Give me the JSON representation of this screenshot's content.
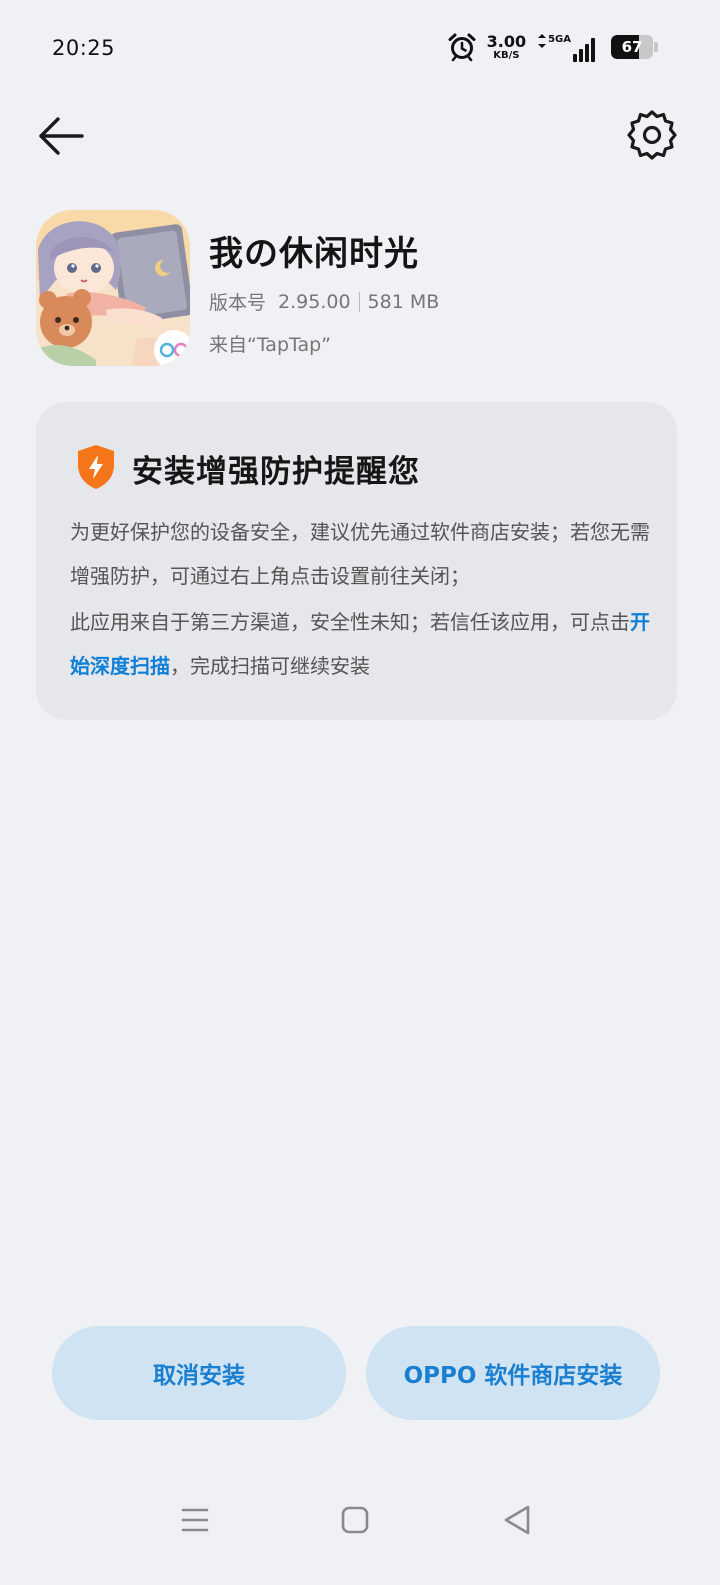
{
  "status_bar": {
    "time": "20:25",
    "speed_value": "3.00",
    "speed_unit": "KB/S",
    "network_label": "5GA",
    "battery_level": "67",
    "battery_fraction": 0.67
  },
  "nav": {
    "back_icon": "arrow-left-icon",
    "settings_icon": "gear-icon"
  },
  "app": {
    "name": "我の休闲时光",
    "version_label": "版本号",
    "version": "2.95.00",
    "size": "581 MB",
    "source": "来自“TapTap”"
  },
  "warning": {
    "icon": "shield-lightning-icon",
    "title": "安装增强防护提醒您",
    "paragraph1": "为更好保护您的设备安全，建议优先通过软件商店安装；若您无需增强防护，可通过右上角点击设置前往关闭；",
    "paragraph2_prefix": "此应用来自于第三方渠道，安全性未知；若信任该应用，可点击",
    "paragraph2_link": "开始深度扫描",
    "paragraph2_suffix": "，完成扫描可继续安装",
    "accent_color": "#0e7fd8",
    "shield_color": "#f5761a"
  },
  "actions": {
    "cancel_label": "取消安装",
    "store_label": "OPPO 软件商店安装"
  },
  "system_nav": {
    "menu_icon": "menu-icon",
    "home_icon": "home-square-icon",
    "back_icon": "back-triangle-icon"
  }
}
